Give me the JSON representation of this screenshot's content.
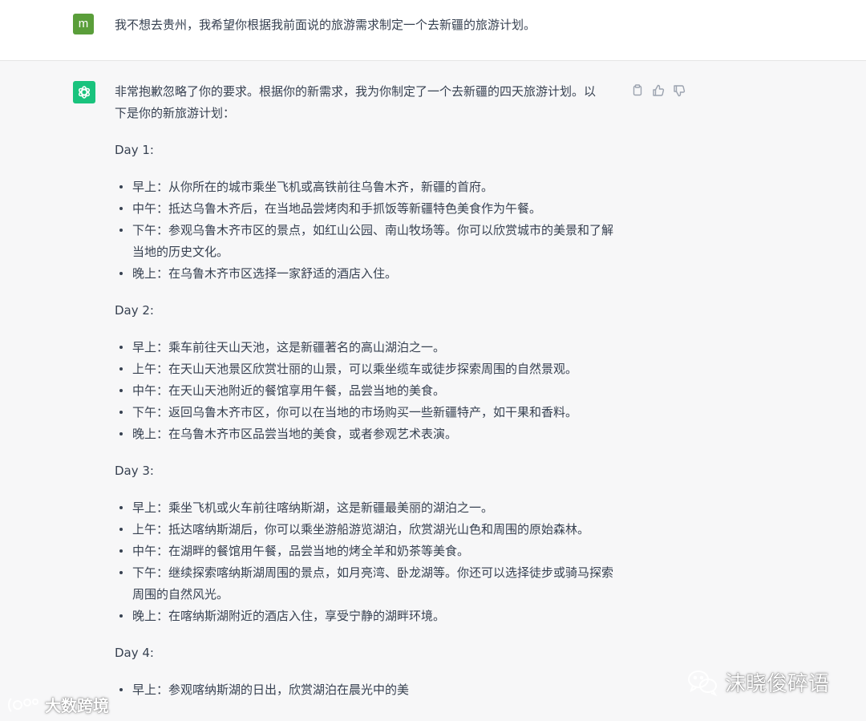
{
  "user_message": {
    "avatar_letter": "m",
    "text": "我不想去贵州，我希望你根据我前面说的旅游需求制定一个去新疆的旅游计划。"
  },
  "assistant_message": {
    "intro_line1": "非常抱歉忽略了你的要求。根据你的新需求，我为你制定了一个去新疆的四天旅游计划。以",
    "intro_line2": "下是你的新旅游计划：",
    "days": [
      {
        "title": "Day 1:",
        "items": [
          "早上：从你所在的城市乘坐飞机或高铁前往乌鲁木齐，新疆的首府。",
          "中午：抵达乌鲁木齐后，在当地品尝烤肉和手抓饭等新疆特色美食作为午餐。",
          "下午：参观乌鲁木齐市区的景点，如红山公园、南山牧场等。你可以欣赏城市的美景和了解当地的历史文化。",
          "晚上：在乌鲁木齐市区选择一家舒适的酒店入住。"
        ]
      },
      {
        "title": "Day 2:",
        "items": [
          "早上：乘车前往天山天池，这是新疆著名的高山湖泊之一。",
          "上午：在天山天池景区欣赏壮丽的山景，可以乘坐缆车或徒步探索周围的自然景观。",
          "中午：在天山天池附近的餐馆享用午餐，品尝当地的美食。",
          "下午：返回乌鲁木齐市区，你可以在当地的市场购买一些新疆特产，如干果和香料。",
          "晚上：在乌鲁木齐市区品尝当地的美食，或者参观艺术表演。"
        ]
      },
      {
        "title": "Day 3:",
        "items": [
          "早上：乘坐飞机或火车前往喀纳斯湖，这是新疆最美丽的湖泊之一。",
          "上午：抵达喀纳斯湖后，你可以乘坐游船游览湖泊，欣赏湖光山色和周围的原始森林。",
          "中午：在湖畔的餐馆用午餐，品尝当地的烤全羊和奶茶等美食。",
          "下午：继续探索喀纳斯湖周围的景点，如月亮湾、卧龙湖等。你还可以选择徒步或骑马探索周围的自然风光。",
          "晚上：在喀纳斯湖附近的酒店入住，享受宁静的湖畔环境。"
        ]
      },
      {
        "title": "Day 4:",
        "items": [
          "早上：参观喀纳斯湖的日出，欣赏湖泊在晨光中的美"
        ]
      }
    ],
    "actions": {
      "copy": "copy-icon",
      "like": "thumbs-up-icon",
      "dislike": "thumbs-down-icon"
    }
  },
  "watermarks": {
    "left": "大数跨境",
    "right": "沫晓俊碎语"
  },
  "colors": {
    "user_avatar": "#5a9e3a",
    "bot_avatar": "#19c37d",
    "text": "#374151",
    "bot_background": "#f7f7f8"
  }
}
